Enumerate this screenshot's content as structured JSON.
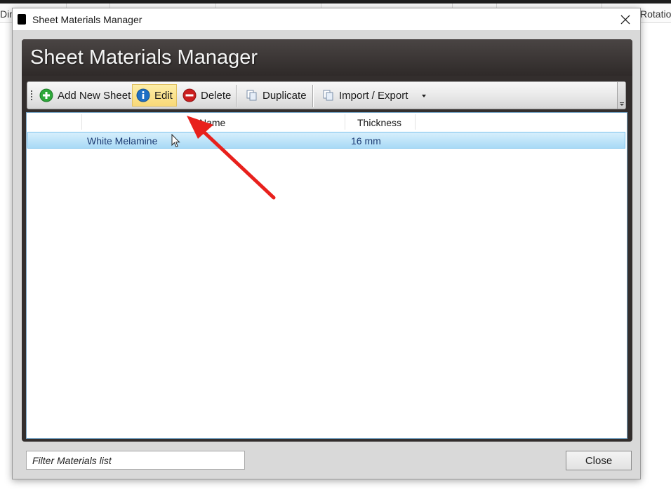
{
  "background": {
    "left_fragment": "Dim",
    "right_fragment": "Rotatio"
  },
  "window": {
    "title": "Sheet Materials Manager",
    "close_glyph": "✕"
  },
  "panel": {
    "title": "Sheet Materials Manager"
  },
  "toolbar": {
    "add_label": "Add New Sheet",
    "edit_label": "Edit",
    "delete_label": "Delete",
    "duplicate_label": "Duplicate",
    "import_export_label": "Import / Export",
    "icons": {
      "add": "plus-circle-icon",
      "edit": "info-icon",
      "delete": "minus-circle-icon",
      "duplicate": "copy-icon",
      "import_export": "copy-icon"
    },
    "colors": {
      "add": "#2ea83a",
      "edit": "#1f6fc4",
      "delete": "#cc1f1f",
      "active_highlight": "#f8d978"
    }
  },
  "grid": {
    "columns": [
      "",
      "Name",
      "Thickness"
    ],
    "rows": [
      {
        "name": "White Melamine",
        "thickness": "16 mm",
        "selected": true
      }
    ],
    "selected_color": "#a9daf6"
  },
  "annotation": {
    "arrow_color": "#e8201c"
  },
  "footer": {
    "filter_placeholder": "Filter Materials list",
    "filter_value": "",
    "close_label": "Close"
  }
}
